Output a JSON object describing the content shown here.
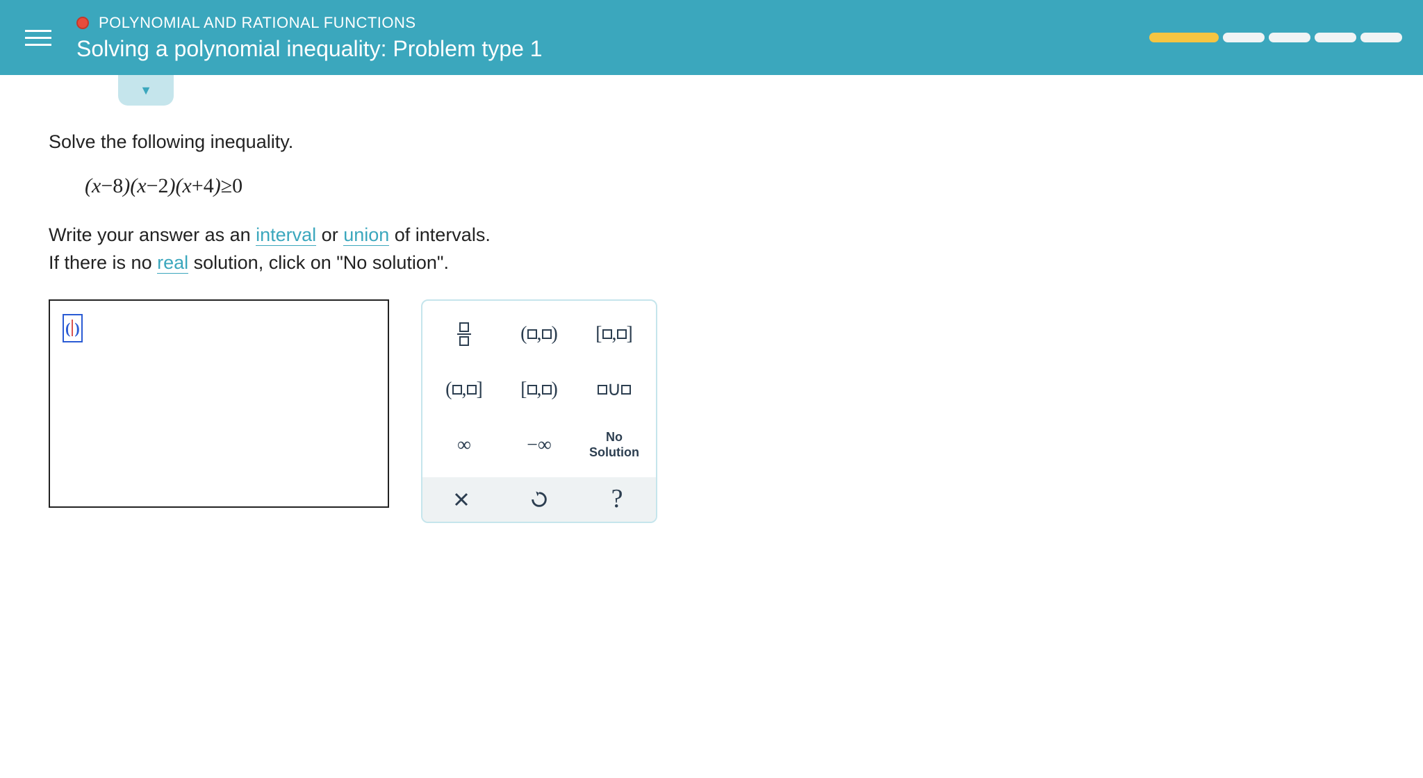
{
  "header": {
    "breadcrumb": "POLYNOMIAL AND RATIONAL FUNCTIONS",
    "title": "Solving a polynomial inequality: Problem type 1"
  },
  "problem": {
    "instruction": "Solve the following inequality.",
    "expression": "(x−8)(x−2)(x+4)≥0",
    "hint_prefix": "Write your answer as an ",
    "link_interval": "interval",
    "hint_mid1": " or ",
    "link_union": "union",
    "hint_suffix1": " of intervals.",
    "hint_line2a": "If there is no ",
    "link_real": "real",
    "hint_line2b": " solution, click on \"No solution\"."
  },
  "keypad": {
    "open_open": "(□,□)",
    "closed_closed": "[□,□]",
    "open_closed": "(□,□]",
    "closed_open": "[□,□)",
    "union": "□∪□",
    "infinity": "∞",
    "neg_infinity": "−∞",
    "no_solution_l1": "No",
    "no_solution_l2": "Solution",
    "clear": "×",
    "undo": "↺",
    "help": "?"
  }
}
